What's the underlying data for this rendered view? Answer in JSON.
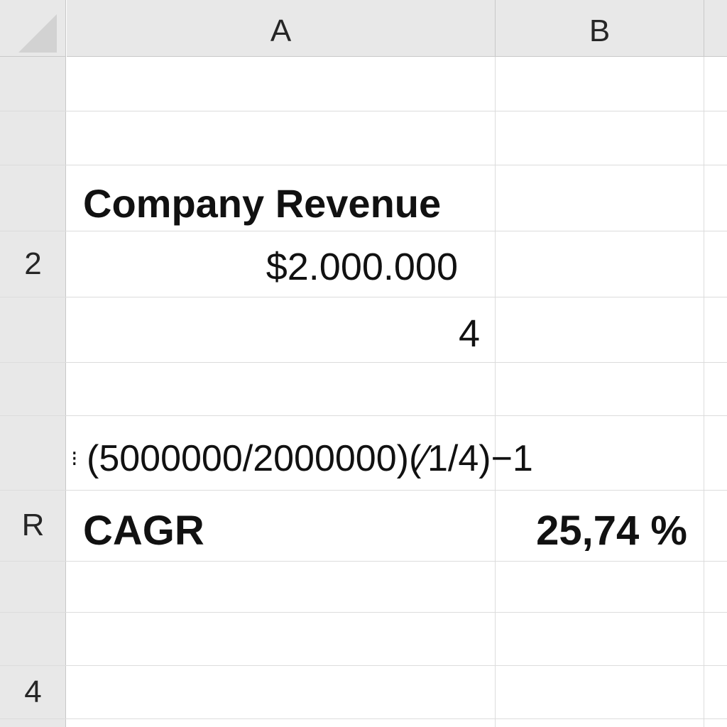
{
  "columns": [
    "A",
    "B"
  ],
  "row_headers": [
    "2",
    "R",
    "4"
  ],
  "cells": {
    "title": "Company Revenue",
    "start_revenue": "$2.000.000",
    "years": "4",
    "formula_marker": "⁝",
    "formula": "(5000000/2000000)(⁄1/4)−1",
    "cagr_label": "CAGR",
    "cagr_value": "25,74 %"
  },
  "colors": {
    "header_background": "#e8e8e8",
    "grid_line": "#dcdcdc",
    "text": "#111111"
  }
}
